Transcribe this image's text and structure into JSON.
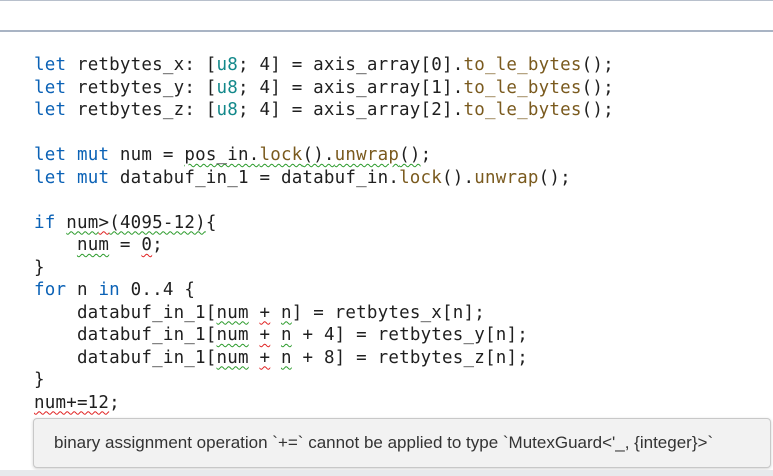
{
  "editor": {
    "code_lines": [
      [
        {
          "cls": "kw",
          "text": "let"
        },
        {
          "cls": "plain",
          "text": " retbytes_x: ["
        },
        {
          "cls": "ty",
          "text": "u8"
        },
        {
          "cls": "plain",
          "text": "; 4] = axis_array[0]."
        },
        {
          "cls": "fn",
          "text": "to_le_bytes"
        },
        {
          "cls": "plain",
          "text": "();"
        }
      ],
      [
        {
          "cls": "kw",
          "text": "let"
        },
        {
          "cls": "plain",
          "text": " retbytes_y: ["
        },
        {
          "cls": "ty",
          "text": "u8"
        },
        {
          "cls": "plain",
          "text": "; 4] = axis_array[1]."
        },
        {
          "cls": "fn",
          "text": "to_le_bytes"
        },
        {
          "cls": "plain",
          "text": "();"
        }
      ],
      [
        {
          "cls": "kw",
          "text": "let"
        },
        {
          "cls": "plain",
          "text": " retbytes_z: ["
        },
        {
          "cls": "ty",
          "text": "u8"
        },
        {
          "cls": "plain",
          "text": "; 4] = axis_array[2]."
        },
        {
          "cls": "fn",
          "text": "to_le_bytes"
        },
        {
          "cls": "plain",
          "text": "();"
        }
      ],
      [],
      [
        {
          "cls": "kw",
          "text": "let"
        },
        {
          "cls": "plain",
          "text": " "
        },
        {
          "cls": "kw",
          "text": "mut"
        },
        {
          "cls": "plain",
          "text": " num = "
        },
        {
          "cls": "plain squig-g",
          "text": "pos_in."
        },
        {
          "cls": "fn squig-g",
          "text": "lock"
        },
        {
          "cls": "plain squig-g",
          "text": "()."
        },
        {
          "cls": "fn squig-g",
          "text": "unwrap"
        },
        {
          "cls": "plain squig-g",
          "text": "()"
        },
        {
          "cls": "plain",
          "text": ";"
        }
      ],
      [
        {
          "cls": "kw",
          "text": "let"
        },
        {
          "cls": "plain",
          "text": " "
        },
        {
          "cls": "kw",
          "text": "mut"
        },
        {
          "cls": "plain",
          "text": " databuf_in_1 = databuf_in."
        },
        {
          "cls": "fn",
          "text": "lock"
        },
        {
          "cls": "plain",
          "text": "()."
        },
        {
          "cls": "fn",
          "text": "unwrap"
        },
        {
          "cls": "plain",
          "text": "();"
        }
      ],
      [],
      [
        {
          "cls": "kw",
          "text": "if"
        },
        {
          "cls": "plain",
          "text": " "
        },
        {
          "cls": "plain squig-g",
          "text": "num"
        },
        {
          "cls": "plain squig-r",
          "text": ">"
        },
        {
          "cls": "plain squig-g",
          "text": "(4095-12)"
        },
        {
          "cls": "plain",
          "text": "{"
        }
      ],
      [
        {
          "cls": "plain",
          "text": "    "
        },
        {
          "cls": "plain squig-g",
          "text": "num"
        },
        {
          "cls": "plain",
          "text": " = "
        },
        {
          "cls": "plain squig-r",
          "text": "0"
        },
        {
          "cls": "plain",
          "text": ";"
        }
      ],
      [
        {
          "cls": "plain",
          "text": "}"
        }
      ],
      [
        {
          "cls": "kw",
          "text": "for"
        },
        {
          "cls": "plain",
          "text": " n "
        },
        {
          "cls": "kw",
          "text": "in"
        },
        {
          "cls": "plain",
          "text": " 0..4 {"
        }
      ],
      [
        {
          "cls": "plain",
          "text": "    databuf_in_1["
        },
        {
          "cls": "plain squig-g",
          "text": "num"
        },
        {
          "cls": "plain",
          "text": " "
        },
        {
          "cls": "plain squig-r",
          "text": "+"
        },
        {
          "cls": "plain",
          "text": " "
        },
        {
          "cls": "plain squig-g",
          "text": "n"
        },
        {
          "cls": "plain",
          "text": "] = retbytes_x[n];"
        }
      ],
      [
        {
          "cls": "plain",
          "text": "    databuf_in_1["
        },
        {
          "cls": "plain squig-g",
          "text": "num"
        },
        {
          "cls": "plain",
          "text": " "
        },
        {
          "cls": "plain squig-r",
          "text": "+"
        },
        {
          "cls": "plain",
          "text": " "
        },
        {
          "cls": "plain squig-g",
          "text": "n"
        },
        {
          "cls": "plain",
          "text": " + 4] = retbytes_y[n];"
        }
      ],
      [
        {
          "cls": "plain",
          "text": "    databuf_in_1["
        },
        {
          "cls": "plain squig-g",
          "text": "num"
        },
        {
          "cls": "plain",
          "text": " "
        },
        {
          "cls": "plain squig-r",
          "text": "+"
        },
        {
          "cls": "plain",
          "text": " "
        },
        {
          "cls": "plain squig-g",
          "text": "n"
        },
        {
          "cls": "plain",
          "text": " + 8] = retbytes_z[n];"
        }
      ],
      [
        {
          "cls": "plain",
          "text": "}"
        }
      ],
      [
        {
          "cls": "plain squig-r",
          "text": "num+=12"
        },
        {
          "cls": "plain",
          "text": ";"
        }
      ]
    ]
  },
  "tooltip": {
    "message": "binary assignment operation `+=` cannot be applied to type `MutexGuard<'_, {integer}>`"
  },
  "colors": {
    "keyword": "#0b62b6",
    "type": "#12888a",
    "function": "#7a5a1e",
    "text": "#1f1f1f",
    "warning_squiggle": "#2a9a2a",
    "error_squiggle": "#e02020"
  }
}
